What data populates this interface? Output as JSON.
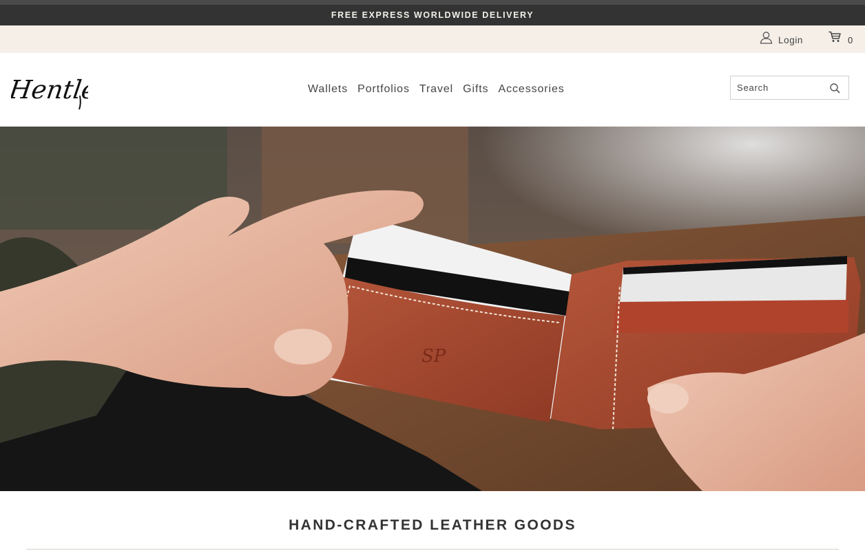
{
  "announcement": {
    "text": "FREE EXPRESS WORLDWIDE DELIVERY"
  },
  "utility": {
    "login_label": "Login",
    "login_icon": "user-icon",
    "cart_icon": "cart-icon",
    "cart_count": "0"
  },
  "brand": {
    "logo_text": "Hentley"
  },
  "nav": {
    "items": [
      {
        "label": "Wallets"
      },
      {
        "label": "Portfolios"
      },
      {
        "label": "Travel"
      },
      {
        "label": "Gifts"
      },
      {
        "label": "Accessories"
      }
    ]
  },
  "search": {
    "placeholder": "Search",
    "icon": "search-icon"
  },
  "hero": {
    "monogram": "SP"
  },
  "section": {
    "heading": "HAND-CRAFTED LEATHER GOODS"
  },
  "colors": {
    "announcement_bg": "#333333",
    "utility_bg": "#f5efe8",
    "text": "#333333",
    "leather": "#a9482f"
  }
}
